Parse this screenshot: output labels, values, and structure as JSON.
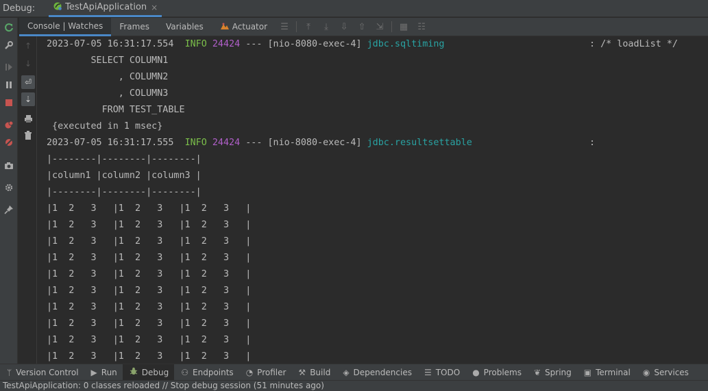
{
  "debug_bar": {
    "label": "Debug:",
    "session_tab": "TestApiApplication",
    "close_glyph": "×"
  },
  "tabs": [
    {
      "label": "Console | Watches",
      "active": true
    },
    {
      "label": "Frames",
      "active": false
    },
    {
      "label": "Variables",
      "active": false
    },
    {
      "label": "Actuator",
      "active": false
    }
  ],
  "console": {
    "lines": {
      "l1": {
        "ts": "2023-07-05 16:31:17.554",
        "level": "INFO",
        "pid": "24424",
        "thread": "--- [nio-8080-exec-4]",
        "logger": "jdbc.sqltiming",
        "msg": ": /* loadList */"
      },
      "l2": "        SELECT COLUMN1",
      "l3": "             , COLUMN2",
      "l4": "             , COLUMN3",
      "l5": "          FROM TEST_TABLE",
      "l6": " {executed in 1 msec}",
      "l7": {
        "ts": "2023-07-05 16:31:17.555",
        "level": "INFO",
        "pid": "24424",
        "thread": "--- [nio-8080-exec-4]",
        "logger": "jdbc.resultsettable",
        "msg": ":"
      },
      "l8": "|--------|--------|--------|",
      "l9": "|column1 |column2 |column3 |",
      "l10": "|--------|--------|--------|",
      "row": "|1  2   3   |1  2   3   |1  2   3   |"
    }
  },
  "bottom_bar": [
    {
      "label": "Version Control",
      "icon": "branch-icon"
    },
    {
      "label": "Run",
      "icon": "play-icon"
    },
    {
      "label": "Debug",
      "icon": "bug-icon"
    },
    {
      "label": "Endpoints",
      "icon": "endpoints-icon"
    },
    {
      "label": "Profiler",
      "icon": "profiler-icon"
    },
    {
      "label": "Build",
      "icon": "hammer-icon"
    },
    {
      "label": "Dependencies",
      "icon": "layers-icon"
    },
    {
      "label": "TODO",
      "icon": "list-icon"
    },
    {
      "label": "Problems",
      "icon": "info-icon"
    },
    {
      "label": "Spring",
      "icon": "spring-leaf-icon"
    },
    {
      "label": "Terminal",
      "icon": "terminal-icon"
    },
    {
      "label": "Services",
      "icon": "services-icon"
    }
  ],
  "status": "TestApiApplication: 0 classes reloaded // Stop debug session (51 minutes ago)",
  "colors": {
    "info": "#7bbf4a",
    "pid": "#b05fc9",
    "logger": "#29a3a3",
    "accent": "#4a88c7"
  }
}
